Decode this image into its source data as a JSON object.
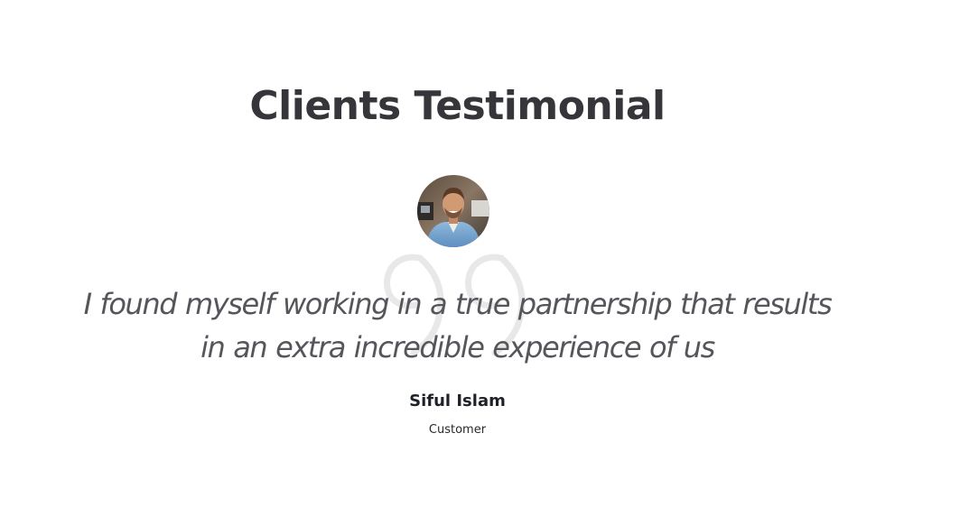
{
  "section": {
    "title": "Clients Testimonial"
  },
  "testimonial": {
    "quote_line_1": "I found myself working in a true partnership that results",
    "quote_line_2": "in an extra incredible experience of us",
    "author_name": "Siful Islam",
    "author_role": "Customer"
  },
  "colors": {
    "heading": "#35353a",
    "quote_text": "#55555b",
    "quote_mark": "#e8e8e8",
    "author_name": "#1e2129"
  },
  "icons": {
    "quote": "quote-mark-icon"
  }
}
